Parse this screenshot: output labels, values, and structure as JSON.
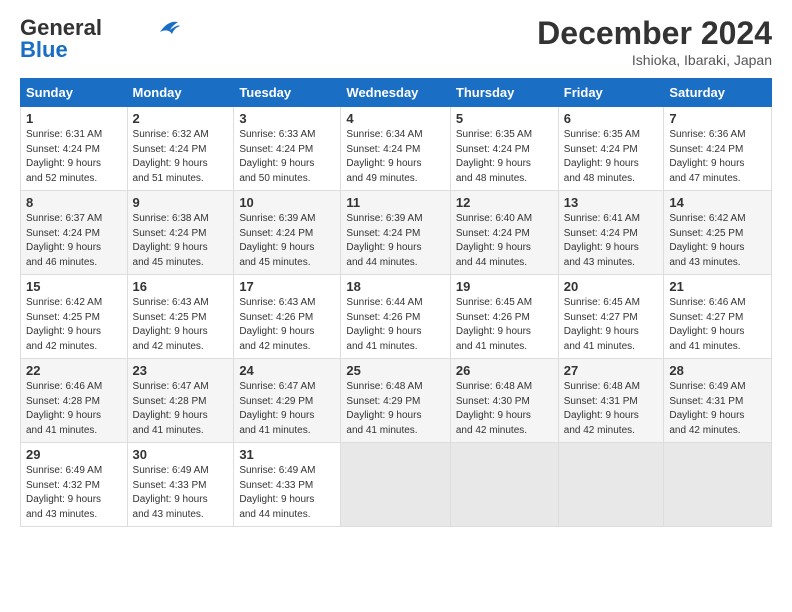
{
  "logo": {
    "line1": "General",
    "line2": "Blue"
  },
  "header": {
    "title": "December 2024",
    "location": "Ishioka, Ibaraki, Japan"
  },
  "days_of_week": [
    "Sunday",
    "Monday",
    "Tuesday",
    "Wednesday",
    "Thursday",
    "Friday",
    "Saturday"
  ],
  "weeks": [
    [
      {
        "num": "1",
        "info": "Sunrise: 6:31 AM\nSunset: 4:24 PM\nDaylight: 9 hours\nand 52 minutes."
      },
      {
        "num": "2",
        "info": "Sunrise: 6:32 AM\nSunset: 4:24 PM\nDaylight: 9 hours\nand 51 minutes."
      },
      {
        "num": "3",
        "info": "Sunrise: 6:33 AM\nSunset: 4:24 PM\nDaylight: 9 hours\nand 50 minutes."
      },
      {
        "num": "4",
        "info": "Sunrise: 6:34 AM\nSunset: 4:24 PM\nDaylight: 9 hours\nand 49 minutes."
      },
      {
        "num": "5",
        "info": "Sunrise: 6:35 AM\nSunset: 4:24 PM\nDaylight: 9 hours\nand 48 minutes."
      },
      {
        "num": "6",
        "info": "Sunrise: 6:35 AM\nSunset: 4:24 PM\nDaylight: 9 hours\nand 48 minutes."
      },
      {
        "num": "7",
        "info": "Sunrise: 6:36 AM\nSunset: 4:24 PM\nDaylight: 9 hours\nand 47 minutes."
      }
    ],
    [
      {
        "num": "8",
        "info": "Sunrise: 6:37 AM\nSunset: 4:24 PM\nDaylight: 9 hours\nand 46 minutes."
      },
      {
        "num": "9",
        "info": "Sunrise: 6:38 AM\nSunset: 4:24 PM\nDaylight: 9 hours\nand 45 minutes."
      },
      {
        "num": "10",
        "info": "Sunrise: 6:39 AM\nSunset: 4:24 PM\nDaylight: 9 hours\nand 45 minutes."
      },
      {
        "num": "11",
        "info": "Sunrise: 6:39 AM\nSunset: 4:24 PM\nDaylight: 9 hours\nand 44 minutes."
      },
      {
        "num": "12",
        "info": "Sunrise: 6:40 AM\nSunset: 4:24 PM\nDaylight: 9 hours\nand 44 minutes."
      },
      {
        "num": "13",
        "info": "Sunrise: 6:41 AM\nSunset: 4:24 PM\nDaylight: 9 hours\nand 43 minutes."
      },
      {
        "num": "14",
        "info": "Sunrise: 6:42 AM\nSunset: 4:25 PM\nDaylight: 9 hours\nand 43 minutes."
      }
    ],
    [
      {
        "num": "15",
        "info": "Sunrise: 6:42 AM\nSunset: 4:25 PM\nDaylight: 9 hours\nand 42 minutes."
      },
      {
        "num": "16",
        "info": "Sunrise: 6:43 AM\nSunset: 4:25 PM\nDaylight: 9 hours\nand 42 minutes."
      },
      {
        "num": "17",
        "info": "Sunrise: 6:43 AM\nSunset: 4:26 PM\nDaylight: 9 hours\nand 42 minutes."
      },
      {
        "num": "18",
        "info": "Sunrise: 6:44 AM\nSunset: 4:26 PM\nDaylight: 9 hours\nand 41 minutes."
      },
      {
        "num": "19",
        "info": "Sunrise: 6:45 AM\nSunset: 4:26 PM\nDaylight: 9 hours\nand 41 minutes."
      },
      {
        "num": "20",
        "info": "Sunrise: 6:45 AM\nSunset: 4:27 PM\nDaylight: 9 hours\nand 41 minutes."
      },
      {
        "num": "21",
        "info": "Sunrise: 6:46 AM\nSunset: 4:27 PM\nDaylight: 9 hours\nand 41 minutes."
      }
    ],
    [
      {
        "num": "22",
        "info": "Sunrise: 6:46 AM\nSunset: 4:28 PM\nDaylight: 9 hours\nand 41 minutes."
      },
      {
        "num": "23",
        "info": "Sunrise: 6:47 AM\nSunset: 4:28 PM\nDaylight: 9 hours\nand 41 minutes."
      },
      {
        "num": "24",
        "info": "Sunrise: 6:47 AM\nSunset: 4:29 PM\nDaylight: 9 hours\nand 41 minutes."
      },
      {
        "num": "25",
        "info": "Sunrise: 6:48 AM\nSunset: 4:29 PM\nDaylight: 9 hours\nand 41 minutes."
      },
      {
        "num": "26",
        "info": "Sunrise: 6:48 AM\nSunset: 4:30 PM\nDaylight: 9 hours\nand 42 minutes."
      },
      {
        "num": "27",
        "info": "Sunrise: 6:48 AM\nSunset: 4:31 PM\nDaylight: 9 hours\nand 42 minutes."
      },
      {
        "num": "28",
        "info": "Sunrise: 6:49 AM\nSunset: 4:31 PM\nDaylight: 9 hours\nand 42 minutes."
      }
    ],
    [
      {
        "num": "29",
        "info": "Sunrise: 6:49 AM\nSunset: 4:32 PM\nDaylight: 9 hours\nand 43 minutes."
      },
      {
        "num": "30",
        "info": "Sunrise: 6:49 AM\nSunset: 4:33 PM\nDaylight: 9 hours\nand 43 minutes."
      },
      {
        "num": "31",
        "info": "Sunrise: 6:49 AM\nSunset: 4:33 PM\nDaylight: 9 hours\nand 44 minutes."
      },
      null,
      null,
      null,
      null
    ]
  ]
}
